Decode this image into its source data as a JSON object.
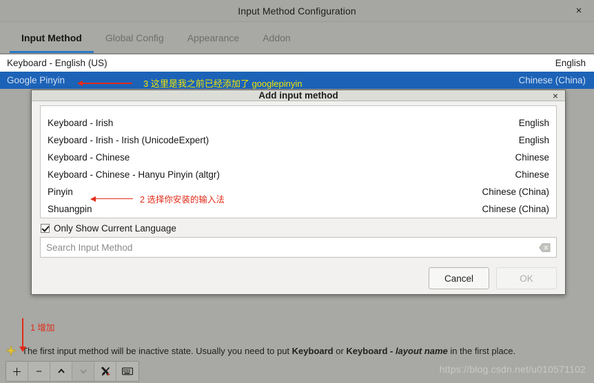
{
  "window": {
    "title": "Input Method Configuration",
    "close_icon": "close-icon",
    "close_label": "×"
  },
  "tabs": [
    {
      "label": "Input Method",
      "active": true
    },
    {
      "label": "Global Config",
      "active": false
    },
    {
      "label": "Appearance",
      "active": false
    },
    {
      "label": "Addon",
      "active": false
    }
  ],
  "input_method_list": {
    "rows": [
      {
        "name": "Keyboard - English (US)",
        "language": "English",
        "selected": false
      },
      {
        "name": "Google Pinyin",
        "language": "Chinese (China)",
        "selected": true
      }
    ]
  },
  "annotations": {
    "one": {
      "number": "1",
      "text": "1 增加",
      "color": "#e22b18"
    },
    "two": {
      "text": "2 选择你安装的输入法",
      "color": "#e22b18"
    },
    "three": {
      "text": "3 这里是我之前已经添加了 googlepinyin",
      "color": "#f2e500"
    }
  },
  "dialog": {
    "title": "Add input method",
    "close_label": "×",
    "rows": [
      {
        "name": "Keyboard - Irish",
        "language": "English"
      },
      {
        "name": "Keyboard - Irish - Irish (UnicodeExpert)",
        "language": "English"
      },
      {
        "name": "Keyboard - Chinese",
        "language": "Chinese"
      },
      {
        "name": "Keyboard - Chinese - Hanyu Pinyin (altgr)",
        "language": "Chinese"
      },
      {
        "name": "Pinyin",
        "language": "Chinese (China)"
      },
      {
        "name": "Shuangpin",
        "language": "Chinese (China)"
      }
    ],
    "checkbox": {
      "label": "Only Show Current Language",
      "checked": true
    },
    "search": {
      "value": "",
      "placeholder": "Search Input Method",
      "clear_icon": "clear-backspace-icon"
    },
    "buttons": {
      "cancel": "Cancel",
      "ok": "OK",
      "ok_disabled": true
    }
  },
  "status": {
    "hint_icon": "sparkle-icon",
    "hint_prefix": "The first input method will be inactive state. Usually you need to put ",
    "hint_bold1": "Keyboard",
    "hint_mid": " or ",
    "hint_bold2": "Keyboard - ",
    "hint_italic": "layout name",
    "hint_suffix": " in the first place."
  },
  "toolbar": {
    "buttons": [
      {
        "name": "add-button",
        "glyph": "＋",
        "disabled": false
      },
      {
        "name": "remove-button",
        "glyph": "−",
        "disabled": false
      },
      {
        "name": "move-up-button",
        "glyph": "⌃",
        "disabled": false
      },
      {
        "name": "move-down-button",
        "glyph": "⌄",
        "disabled": true
      },
      {
        "name": "configure-button",
        "glyph": "tools-icon",
        "disabled": false
      },
      {
        "name": "keyboard-layout-button",
        "glyph": "keyboard-icon",
        "disabled": false
      }
    ]
  },
  "watermark": {
    "text": "https://blog.csdn.net/u010571102"
  },
  "colors": {
    "accent": "#2a79c4",
    "selection": "#1c63b8",
    "annotation_red": "#e22b18",
    "annotation_yellow": "#f2e500",
    "window_bg": "#a8a8a4"
  }
}
